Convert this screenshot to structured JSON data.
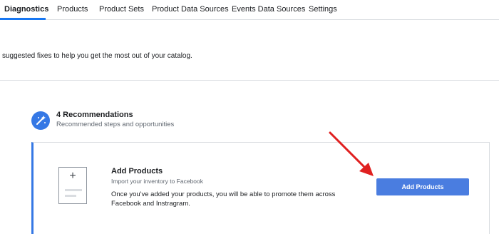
{
  "nav": {
    "tabs": [
      {
        "label": "Diagnostics",
        "active": true
      },
      {
        "label": "Products",
        "active": false
      },
      {
        "label": "Product Sets",
        "active": false
      },
      {
        "label": "Product Data Sources",
        "active": false
      },
      {
        "label": "Events Data Sources",
        "active": false
      },
      {
        "label": "Settings",
        "active": false
      }
    ]
  },
  "intro": {
    "text": "suggested fixes to help you get the most out of your catalog."
  },
  "recommendations": {
    "title": "4 Recommendations",
    "subtitle": "Recommended steps and opportunities",
    "icon": "magic-wand-icon"
  },
  "card": {
    "title": "Add Products",
    "subtitle": "Import your inventory to Facebook",
    "description": "Once you've added your products, you will be able to promote them across Facebook and Instragram.",
    "button_label": "Add Products",
    "thumbnail_icon": "plus-icon"
  },
  "colors": {
    "accent": "#3578e5",
    "button": "#4a7de0",
    "annotation_arrow": "#e02020"
  }
}
